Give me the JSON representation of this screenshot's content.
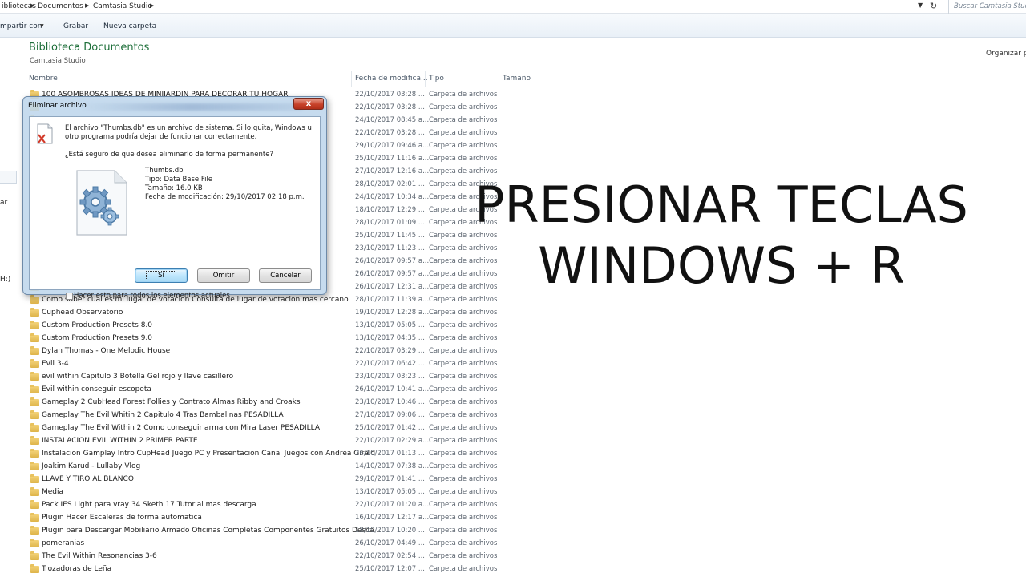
{
  "address": {
    "crumbs": [
      "ibliotecas",
      "Documentos",
      "Camtasia Studio"
    ],
    "search_placeholder": "Buscar Camtasia Studio"
  },
  "toolbar": {
    "share_label": "mpartir con",
    "burn_label": "Grabar",
    "new_folder_label": "Nueva carpeta"
  },
  "nav": {
    "frag1": "ar",
    "frag2": "H:)"
  },
  "library": {
    "title": "Biblioteca Documentos",
    "subtitle": "Camtasia Studio",
    "organize": "Organizar po"
  },
  "columns": {
    "name": "Nombre",
    "date": "Fecha de modifica...",
    "type": "Tipo",
    "size": "Tamaño"
  },
  "rows": [
    {
      "name": "100 ASOMBROSAS IDEAS DE MINIJARDIN PARA DECORAR TU HOGAR",
      "date": "22/10/2017 03:28 ...",
      "type": "Carpeta de archivos"
    },
    {
      "name": "",
      "date": "22/10/2017 03:28 ...",
      "type": "Carpeta de archivos"
    },
    {
      "name": "",
      "date": "24/10/2017 08:45 a...",
      "type": "Carpeta de archivos"
    },
    {
      "name": "",
      "date": "22/10/2017 03:28 ...",
      "type": "Carpeta de archivos"
    },
    {
      "name": "",
      "date": "29/10/2017 09:46 a...",
      "type": "Carpeta de archivos"
    },
    {
      "name": "",
      "date": "25/10/2017 11:16 a...",
      "type": "Carpeta de archivos"
    },
    {
      "name": "",
      "date": "27/10/2017 12:16 a...",
      "type": "Carpeta de archivos"
    },
    {
      "name": "",
      "date": "28/10/2017 02:01 ...",
      "type": "Carpeta de archivos"
    },
    {
      "name": "",
      "date": "24/10/2017 10:34 a...",
      "type": "Carpeta de archivos"
    },
    {
      "name": "",
      "date": "18/10/2017 12:29 ...",
      "type": "Carpeta de archivos"
    },
    {
      "name": "",
      "date": "28/10/2017 01:09 ...",
      "type": "Carpeta de archivos"
    },
    {
      "name": "",
      "date": "25/10/2017 11:45 ...",
      "type": "Carpeta de archivos"
    },
    {
      "name": "",
      "date": "23/10/2017 11:23 ...",
      "type": "Carpeta de archivos"
    },
    {
      "name": "",
      "date": "26/10/2017 09:57 a...",
      "type": "Carpeta de archivos"
    },
    {
      "name": "",
      "date": "26/10/2017 09:57 a...",
      "type": "Carpeta de archivos"
    },
    {
      "name": "",
      "date": "26/10/2017 12:31 a...",
      "type": "Carpeta de archivos"
    },
    {
      "name": "Como saber cual es mi lugar de votacion Consulta de lugar de votacion mas cercano",
      "date": "28/10/2017 11:39 a...",
      "type": "Carpeta de archivos"
    },
    {
      "name": "Cuphead Observatorio",
      "date": "19/10/2017 12:28 a...",
      "type": "Carpeta de archivos"
    },
    {
      "name": "Custom Production Presets 8.0",
      "date": "13/10/2017 05:05 ...",
      "type": "Carpeta de archivos"
    },
    {
      "name": "Custom Production Presets 9.0",
      "date": "13/10/2017 04:35 ...",
      "type": "Carpeta de archivos"
    },
    {
      "name": "Dylan Thomas - One Melodic House",
      "date": "22/10/2017 03:29 ...",
      "type": "Carpeta de archivos"
    },
    {
      "name": "Evil 3-4",
      "date": "22/10/2017 06:42 ...",
      "type": "Carpeta de archivos"
    },
    {
      "name": "evil within Capitulo 3 Botella Gel rojo y llave casillero",
      "date": "23/10/2017 03:23 ...",
      "type": "Carpeta de archivos"
    },
    {
      "name": "Evil within conseguir escopeta",
      "date": "26/10/2017 10:41 a...",
      "type": "Carpeta de archivos"
    },
    {
      "name": "Gameplay 2 CubHead Forest Follies y Contrato Almas Ribby and Croaks",
      "date": "23/10/2017 10:46 ...",
      "type": "Carpeta de archivos"
    },
    {
      "name": "Gameplay The Evil Whitin 2 Capitulo 4 Tras Bambalinas PESADILLA",
      "date": "27/10/2017 09:06 ...",
      "type": "Carpeta de archivos"
    },
    {
      "name": "Gameplay The Evil Within 2 Como conseguir arma con Mira Laser PESADILLA",
      "date": "25/10/2017 01:42 ...",
      "type": "Carpeta de archivos"
    },
    {
      "name": "INSTALACION EVIL WITHIN 2 PRIMER PARTE",
      "date": "22/10/2017 02:29 a...",
      "type": "Carpeta de archivos"
    },
    {
      "name": "Instalacion Gamplay Intro CupHead Juego PC y Presentacion Canal Juegos con Andrea Girald",
      "date": "26/10/2017 01:13 ...",
      "type": "Carpeta de archivos"
    },
    {
      "name": "Joakim Karud - Lullaby Vlog",
      "date": "14/10/2017 07:38 a...",
      "type": "Carpeta de archivos"
    },
    {
      "name": "LLAVE Y TIRO AL BLANCO",
      "date": "29/10/2017 01:41 ...",
      "type": "Carpeta de archivos"
    },
    {
      "name": "Media",
      "date": "13/10/2017 05:05 ...",
      "type": "Carpeta de archivos"
    },
    {
      "name": "Pack IES Light para vray 34 Sketh 17 Tutorial mas descarga",
      "date": "22/10/2017 01:20 a...",
      "type": "Carpeta de archivos"
    },
    {
      "name": "Plugin Hacer Escaleras de forma automatica",
      "date": "16/10/2017 12:17 a...",
      "type": "Carpeta de archivos"
    },
    {
      "name": "Plugin para Descargar Mobiliario Armado Oficinas Completas Componentes Gratuitos Desca...",
      "date": "18/10/2017 10:20 ...",
      "type": "Carpeta de archivos"
    },
    {
      "name": "pomeranias",
      "date": "26/10/2017 04:49 ...",
      "type": "Carpeta de archivos"
    },
    {
      "name": "The Evil Within Resonancias 3-6",
      "date": "22/10/2017 02:54 ...",
      "type": "Carpeta de archivos"
    },
    {
      "name": "Trozadoras de Leña",
      "date": "25/10/2017 12:07 ...",
      "type": "Carpeta de archivos"
    }
  ],
  "overlay": {
    "line1": "PRESIONAR TECLAS",
    "line2": "WINDOWS + R"
  },
  "dialog": {
    "title": "Eliminar archivo",
    "close_label": "x",
    "message": "El archivo \"Thumbs.db\" es un archivo de sistema. Si lo quita, Windows u otro programa podría dejar de funcionar correctamente.",
    "question": "¿Está seguro de que desea eliminarlo de forma permanente?",
    "file_name": "Thumbs.db",
    "file_type": "Tipo: Data Base File",
    "file_size": "Tamaño: 16.0 KB",
    "file_modified": "Fecha de modificación: 29/10/2017 02:18 p.m.",
    "yes_label": "Sí",
    "skip_label": "Omitir",
    "cancel_label": "Cancelar",
    "checkbox_label": "Hacer esto para todos los elementos actuales",
    "checkbox_checked": false
  }
}
